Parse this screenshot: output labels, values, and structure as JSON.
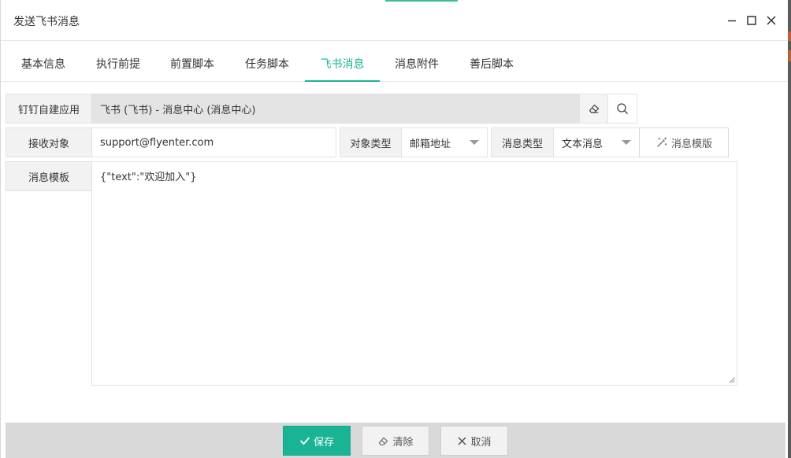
{
  "window": {
    "title": "发送飞书消息"
  },
  "tabs": [
    {
      "label": "基本信息",
      "active": false
    },
    {
      "label": "执行前提",
      "active": false
    },
    {
      "label": "前置脚本",
      "active": false
    },
    {
      "label": "任务脚本",
      "active": false
    },
    {
      "label": "飞书消息",
      "active": true
    },
    {
      "label": "消息附件",
      "active": false
    },
    {
      "label": "善后脚本",
      "active": false
    }
  ],
  "form": {
    "app": {
      "label": "钉钉自建应用",
      "value": "飞书 (飞书) - 消息中心 (消息中心)"
    },
    "recipient": {
      "label": "接收对象",
      "value": "support@flyenter.com"
    },
    "object_type": {
      "label": "对象类型",
      "value": "邮箱地址"
    },
    "message_type": {
      "label": "消息类型",
      "value": "文本消息"
    },
    "template_button": {
      "label": "消息模版"
    },
    "template": {
      "label": "消息模板",
      "value": "{\"text\":\"欢迎加入\"}"
    }
  },
  "footer": {
    "save_label": "保存",
    "clear_label": "清除",
    "cancel_label": "取消"
  },
  "colors": {
    "accent": "#1ab394",
    "footer_bg": "#d9d9d9",
    "readonly_bg": "#e4e4e4",
    "label_bg": "#f2f2f2"
  },
  "icons": {
    "minimize": "minimize-icon",
    "maximize": "maximize-icon",
    "close": "close-icon",
    "eraser": "eraser-icon",
    "search": "search-icon",
    "magic_wand": "magic-wand-icon",
    "check": "check-icon",
    "cancel": "x-icon"
  }
}
